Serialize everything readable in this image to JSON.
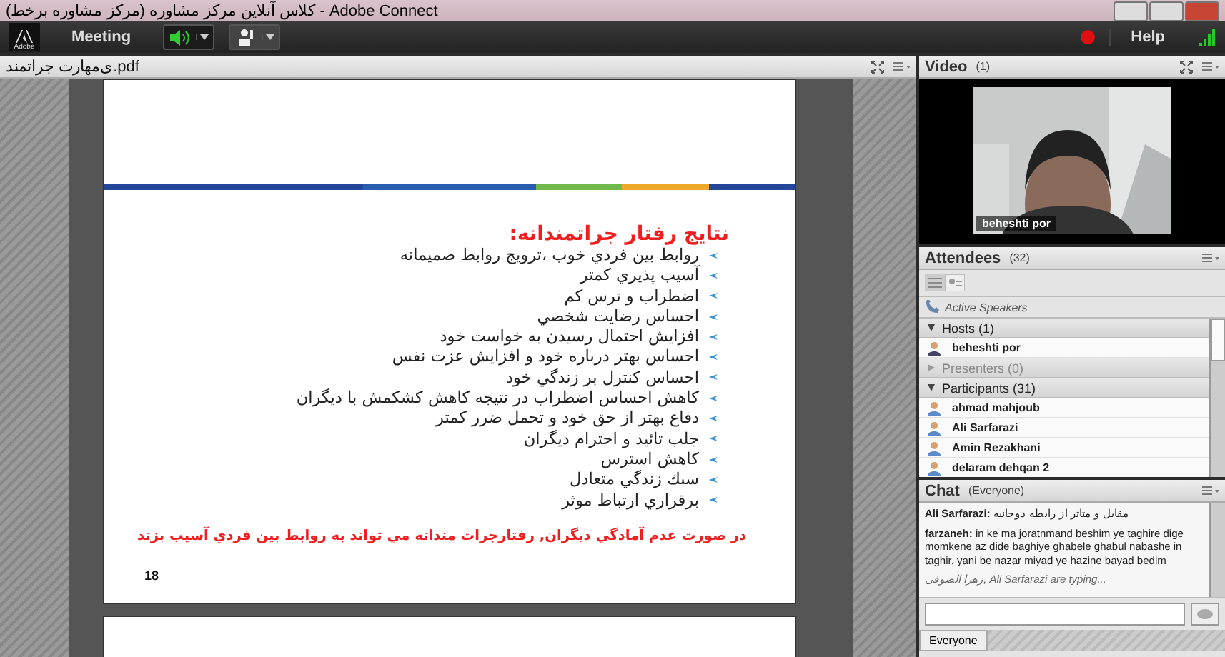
{
  "window": {
    "title": "(کلاس آنلاین مرکز مشاوره (مرکز مشاوره برخط - Adobe Connect"
  },
  "menubar": {
    "logo": "Adobe",
    "menu": "Meeting",
    "speaker_on": true,
    "help": "Help"
  },
  "share": {
    "file": "ی‌مهارت جراتمند.pdf",
    "slide": {
      "heading": "نتايج  رفتار جراتمندانه:",
      "bullets": [
        "روابط بين فردي خوب ،ترويج روابط صميمانه",
        "آسيب پذيري كمتر",
        "اضطراب و ترس كم",
        "احساس رضايت شخصي",
        "افزايش احتمال رسيدن به خواست خود",
        "احساس بهتر درباره خود و افزايش عزت نفس",
        "احساس كنترل بر زندگي خود",
        "كاهش احساس اضطراب در نتيجه كاهش كشكمش با ديگران",
        "دفاع بهتر از حق خود و تحمل ضرر كمتر",
        "جلب تائيد و احترام ديگران",
        "كاهش استرس",
        "سبك زندگي متعادل",
        "برقراري ارتباط موثر"
      ],
      "note": "در صورت عدم آمادگي ديگران, رفتارجرات مندانه مي تواند به روابط بين فردي آسيب بزند",
      "page": "18"
    }
  },
  "video": {
    "title": "Video",
    "count": "(1)",
    "caption": "beheshti por"
  },
  "attendees": {
    "title": "Attendees",
    "count": "(32)",
    "active_speakers": "Active Speakers",
    "groups": [
      {
        "label": "Hosts (1)",
        "expanded": true,
        "children": [
          {
            "name": "beheshti por"
          }
        ]
      },
      {
        "label": "Presenters (0)",
        "expanded": false
      },
      {
        "label": "Participants (31)",
        "expanded": true,
        "children": [
          {
            "name": "ahmad mahjoub"
          },
          {
            "name": "Ali Sarfarazi"
          },
          {
            "name": "Amin Rezakhani"
          },
          {
            "name": "delaram dehqan 2"
          }
        ]
      }
    ]
  },
  "chat": {
    "title": "Chat",
    "scope": "(Everyone)",
    "messages": [
      {
        "sender": "Ali Sarfarazi:",
        "text": "مقابل و متاثر از رابطه دوجانبه"
      },
      {
        "sender": "farzaneh:",
        "text": "in ke ma joratnmand beshim ye taghire dige momkene az dide baghiye ghabele ghabul nabashe in taghir. yani be nazar miyad ye hazine bayad bedim"
      }
    ],
    "typing": "زهرا الصوفی, Ali Sarfarazi are typing...",
    "tab": "Everyone"
  }
}
